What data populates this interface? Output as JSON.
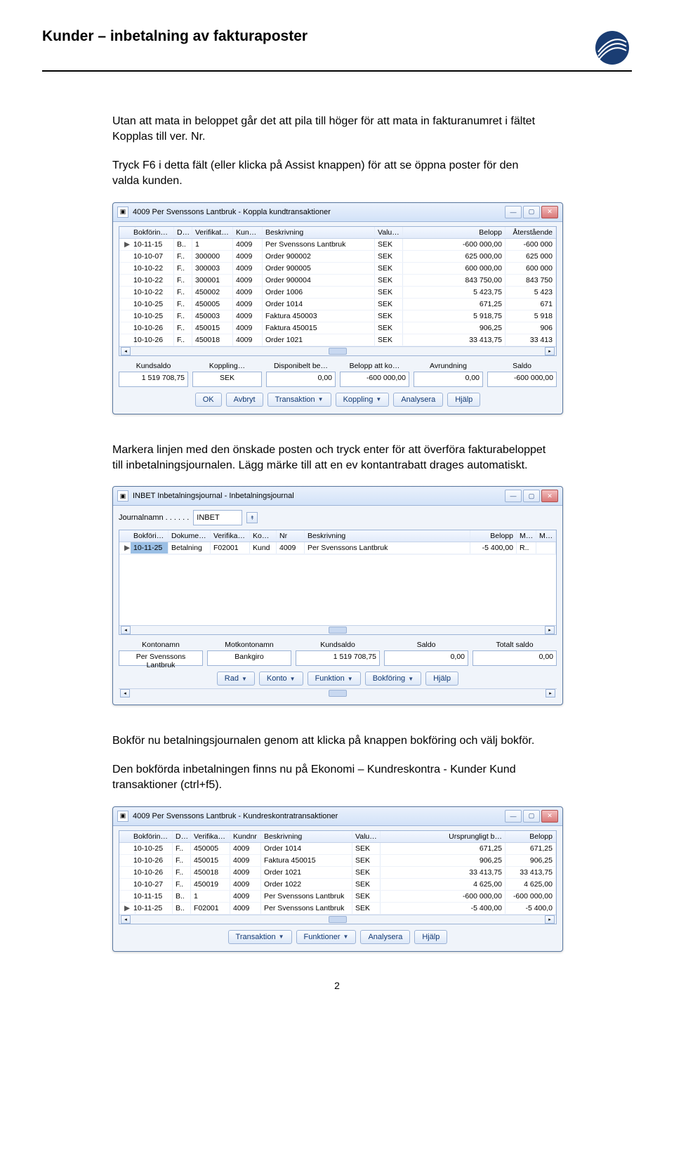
{
  "header": {
    "title": "Kunder – inbetalning av fakturaposter"
  },
  "paragraphs": {
    "p1": "Utan att mata in beloppet går det att pila till höger för att mata in fakturanumret i fältet Kopplas till ver. Nr.",
    "p2": "Tryck F6 i detta fält (eller klicka på Assist knappen) för att se öppna poster för den valda kunden.",
    "p3": "Markera linjen med den önskade posten och tryck enter för att överföra fakturabeloppet till inbetalningsjournalen. Lägg märke till att en ev kontantrabatt drages automatiskt.",
    "p4": "Bokför nu betalningsjournalen genom att klicka på knappen bokföring och välj bokför.",
    "p5": "Den bokförda inbetalningen finns nu på Ekonomi – Kundreskontra - Kunder Kund transaktioner (ctrl+f5).",
    "page_num": "2"
  },
  "win1": {
    "title": "4009 Per Svenssons Lantbruk - Koppla kundtransaktioner",
    "cols": [
      "",
      "Bokföring…",
      "D…",
      "Verifikatio…",
      "Kundnr",
      "Beskrivning",
      "Valut…",
      "Belopp",
      "Återstående"
    ],
    "rows": [
      [
        "▶",
        "10-11-15",
        "B..",
        "1",
        "4009",
        "Per Svenssons Lantbruk",
        "SEK",
        "-600 000,00",
        "-600 000"
      ],
      [
        "",
        "10-10-07",
        "F..",
        "300000",
        "4009",
        "Order 900002",
        "SEK",
        "625 000,00",
        "625 000"
      ],
      [
        "",
        "10-10-22",
        "F..",
        "300003",
        "4009",
        "Order 900005",
        "SEK",
        "600 000,00",
        "600 000"
      ],
      [
        "",
        "10-10-22",
        "F..",
        "300001",
        "4009",
        "Order 900004",
        "SEK",
        "843 750,00",
        "843 750"
      ],
      [
        "",
        "10-10-22",
        "F..",
        "450002",
        "4009",
        "Order 1006",
        "SEK",
        "5 423,75",
        "5 423"
      ],
      [
        "",
        "10-10-25",
        "F..",
        "450005",
        "4009",
        "Order 1014",
        "SEK",
        "671,25",
        "671"
      ],
      [
        "",
        "10-10-25",
        "F..",
        "450003",
        "4009",
        "Faktura 450003",
        "SEK",
        "5 918,75",
        "5 918"
      ],
      [
        "",
        "10-10-26",
        "F..",
        "450015",
        "4009",
        "Faktura 450015",
        "SEK",
        "906,25",
        "906"
      ],
      [
        "",
        "10-10-26",
        "F..",
        "450018",
        "4009",
        "Order 1021",
        "SEK",
        "33 413,75",
        "33 413"
      ]
    ],
    "summary_labels": [
      "Kundsaldo",
      "Koppling…",
      "Disponibelt be…",
      "Belopp att ko…",
      "Avrundning",
      "Saldo"
    ],
    "summary_values": [
      "1 519 708,75",
      "SEK",
      "0,00",
      "-600 000,00",
      "0,00",
      "-600 000,00"
    ],
    "buttons": [
      "OK",
      "Avbryt",
      "Transaktion",
      "Koppling",
      "Analysera",
      "Hjälp"
    ]
  },
  "win2": {
    "title": "INBET Inbetalningsjournal - Inbetalningsjournal",
    "journal_label": "Journalnamn . . . . . .",
    "journal_value": "INBET",
    "cols": [
      "",
      "Bokföring…",
      "Dokume…",
      "Verifikatio…",
      "Kon…",
      "Nr",
      "Beskrivning",
      "Belopp",
      "M…",
      "Motl"
    ],
    "rows": [
      [
        "▶",
        "10-11-25",
        "Betalning",
        "F02001",
        "Kund",
        "4009",
        "Per Svenssons Lantbruk",
        "-5 400,00",
        "R..",
        ""
      ]
    ],
    "summary_labels": [
      "Kontonamn",
      "Motkontonamn",
      "Kundsaldo",
      "Saldo",
      "Totalt saldo"
    ],
    "summary_values": [
      "Per Svenssons Lantbruk",
      "Bankgiro",
      "1 519 708,75",
      "0,00",
      "0,00"
    ],
    "buttons": [
      "Rad",
      "Konto",
      "Funktion",
      "Bokföring",
      "Hjälp"
    ]
  },
  "win3": {
    "title": "4009 Per Svenssons Lantbruk - Kundreskontratransaktioner",
    "cols": [
      "",
      "Bokföring…",
      "D…",
      "Verifikatio…",
      "Kundnr",
      "Beskrivning",
      "Valut…",
      "Ursprungligt b…",
      "Belopp"
    ],
    "rows": [
      [
        "",
        "10-10-25",
        "F..",
        "450005",
        "4009",
        "Order 1014",
        "SEK",
        "671,25",
        "671,25"
      ],
      [
        "",
        "10-10-26",
        "F..",
        "450015",
        "4009",
        "Faktura 450015",
        "SEK",
        "906,25",
        "906,25"
      ],
      [
        "",
        "10-10-26",
        "F..",
        "450018",
        "4009",
        "Order 1021",
        "SEK",
        "33 413,75",
        "33 413,75"
      ],
      [
        "",
        "10-10-27",
        "F..",
        "450019",
        "4009",
        "Order 1022",
        "SEK",
        "4 625,00",
        "4 625,00"
      ],
      [
        "",
        "10-11-15",
        "B..",
        "1",
        "4009",
        "Per Svenssons Lantbruk",
        "SEK",
        "-600 000,00",
        "-600 000,00"
      ],
      [
        "▶",
        "10-11-25",
        "B..",
        "F02001",
        "4009",
        "Per Svenssons Lantbruk",
        "SEK",
        "-5 400,00",
        "-5 400,0"
      ]
    ],
    "buttons": [
      "Transaktion",
      "Funktioner",
      "Analysera",
      "Hjälp"
    ]
  }
}
